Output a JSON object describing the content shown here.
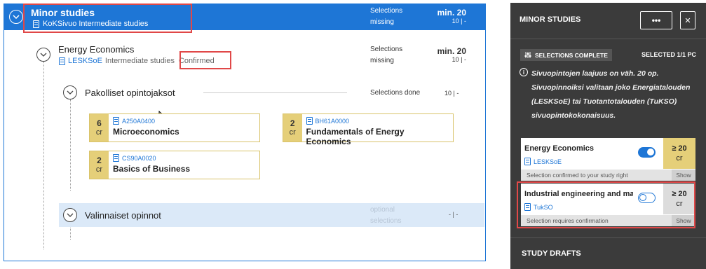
{
  "header": {
    "title": "Minor studies",
    "subtitle": "KoKSivuo Intermediate studies",
    "status_line1": "Selections",
    "status_line2": "missing",
    "min_label": "min. 20",
    "credits_ratio": "10 | -"
  },
  "energy": {
    "title": "Energy Economics",
    "code": "LESKSoE",
    "level": "Intermediate studies",
    "confirmed": "Confirmed",
    "status_line1": "Selections",
    "status_line2": "missing",
    "min_label": "min. 20",
    "credits_ratio": "10 | -"
  },
  "compulsory": {
    "title": "Pakolliset opintojaksot",
    "status": "Selections done",
    "credits_ratio": "10 | -"
  },
  "courses": [
    {
      "code": "A250A0400",
      "name": "Microeconomics",
      "credits": "6",
      "unit": "cr"
    },
    {
      "code": "BH61A0000",
      "name": "Fundamentals of Energy Economics",
      "credits": "2",
      "unit": "cr"
    },
    {
      "code": "CS90A0020",
      "name": "Basics of Business",
      "credits": "2",
      "unit": "cr"
    }
  ],
  "optional": {
    "title": "Valinnaiset opinnot",
    "status_line1": "optional",
    "status_line2": "selections",
    "credits_ratio": "- | -"
  },
  "side": {
    "title": "MINOR STUDIES",
    "more_label": "•••",
    "close_label": "✕",
    "badge": "SELECTIONS COMPLETE",
    "selected": "SELECTED 1/1 PC",
    "info_icon": "i",
    "info": "Sivuopintojen laajuus on väh. 20 op. Sivuopinnoiksi valitaan joko Energiatalouden (LESKSoE) tai Tuotantotalouden (TuKSO) sivuopintokokonaisuus.",
    "options": [
      {
        "name": "Energy Economics",
        "code": "LESKSoE",
        "credits_value": "≥ 20",
        "credits_unit": "cr",
        "footer": "Selection confirmed to your study right",
        "show": "Show",
        "enabled": true,
        "accent": "#e5cf79"
      },
      {
        "name": "Industrial engineering and ma",
        "code": "TukSO",
        "credits_value": "≥ 20",
        "credits_unit": "cr",
        "footer": "Selection requires confirmation",
        "show": "Show",
        "enabled": false,
        "accent": "#dcdcdc"
      }
    ],
    "study_drafts": "STUDY DRAFTS"
  },
  "colors": {
    "primary": "#1e76d6",
    "highlight_red": "#e04848",
    "credit_gold": "#e5cf79",
    "side_bg": "#3b3b3b"
  },
  "icons": {
    "document": "document-icon",
    "chevron": "chevron-down-icon",
    "sliders": "sliders-icon",
    "info": "info-icon"
  }
}
